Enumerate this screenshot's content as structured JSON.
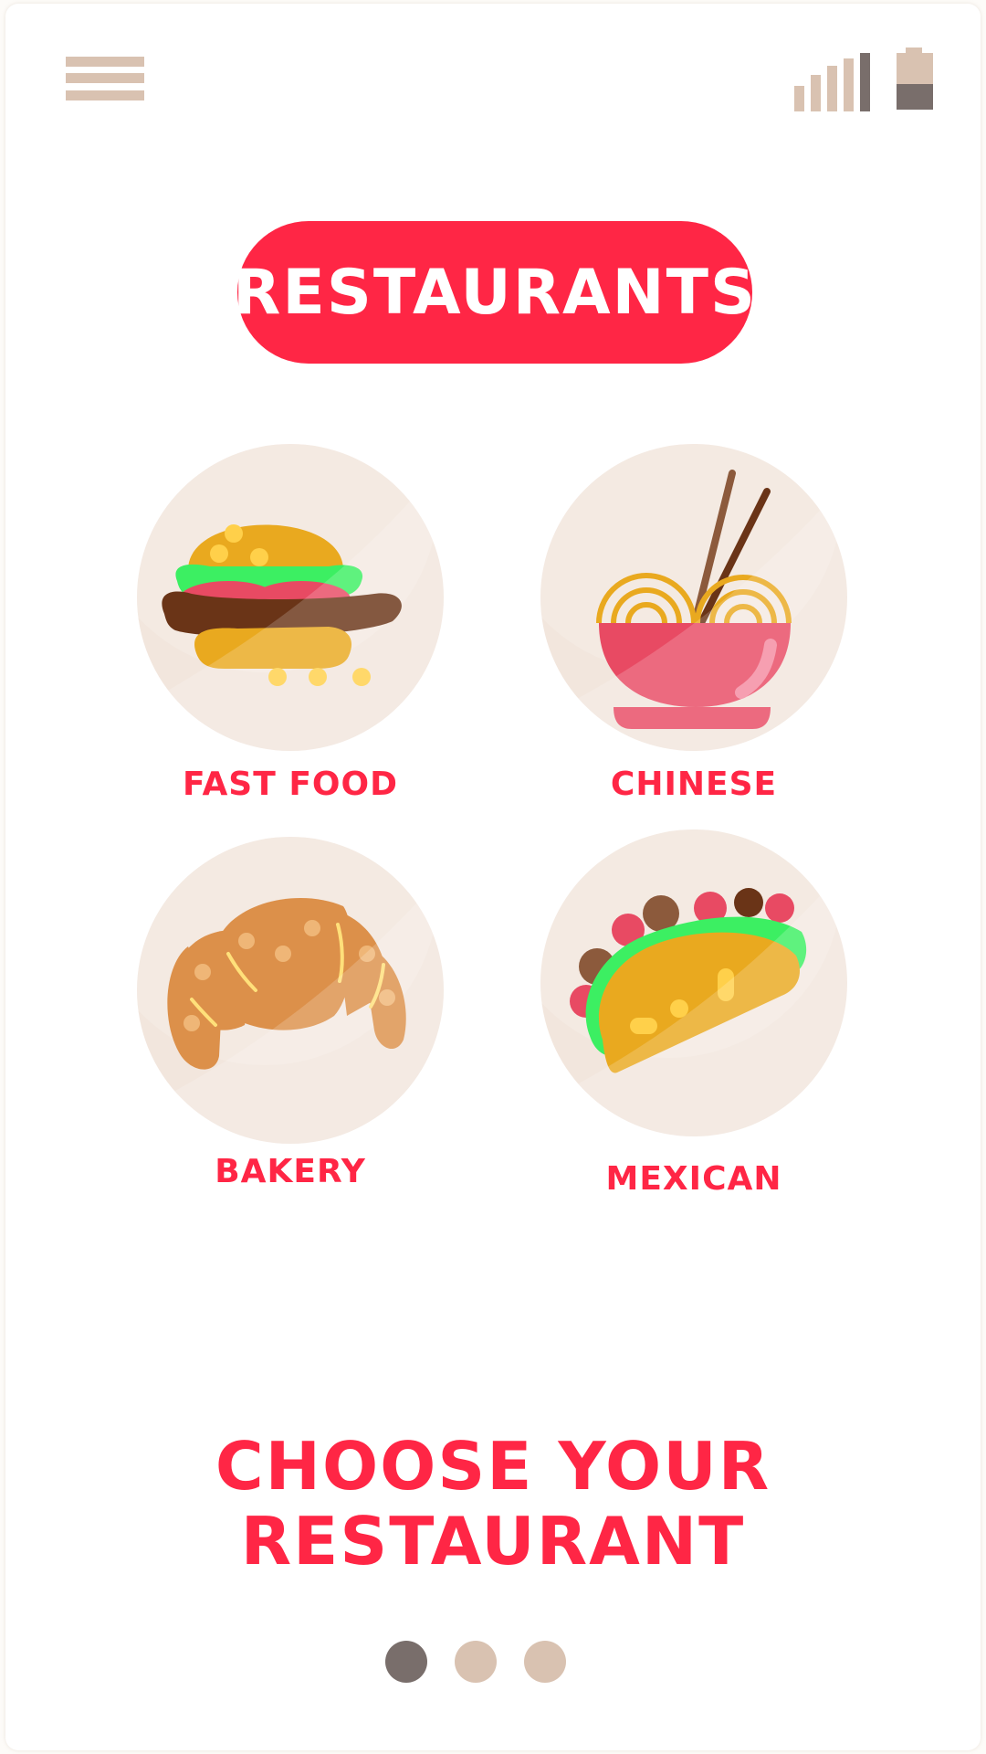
{
  "header": {
    "menu_icon": "hamburger-menu-icon",
    "signal_icon": "signal-strength-icon",
    "signal_bars_active": 5,
    "battery_icon": "battery-icon",
    "battery_level": 0.45
  },
  "title": "RESTAURANTS",
  "categories": [
    {
      "label": "FAST FOOD",
      "icon": "burger-icon"
    },
    {
      "label": "CHINESE",
      "icon": "noodle-bowl-icon"
    },
    {
      "label": "BAKERY",
      "icon": "croissant-icon"
    },
    {
      "label": "MEXICAN",
      "icon": "taco-icon"
    }
  ],
  "headline": {
    "line1": "CHOOSE YOUR",
    "line2": "RESTAURANT"
  },
  "pagination": {
    "total": 3,
    "active": 0
  },
  "colors": {
    "accent": "#ff2645",
    "muted": "#d9c2b1",
    "dark": "#796e6b",
    "circle": "#f2e6dd"
  }
}
